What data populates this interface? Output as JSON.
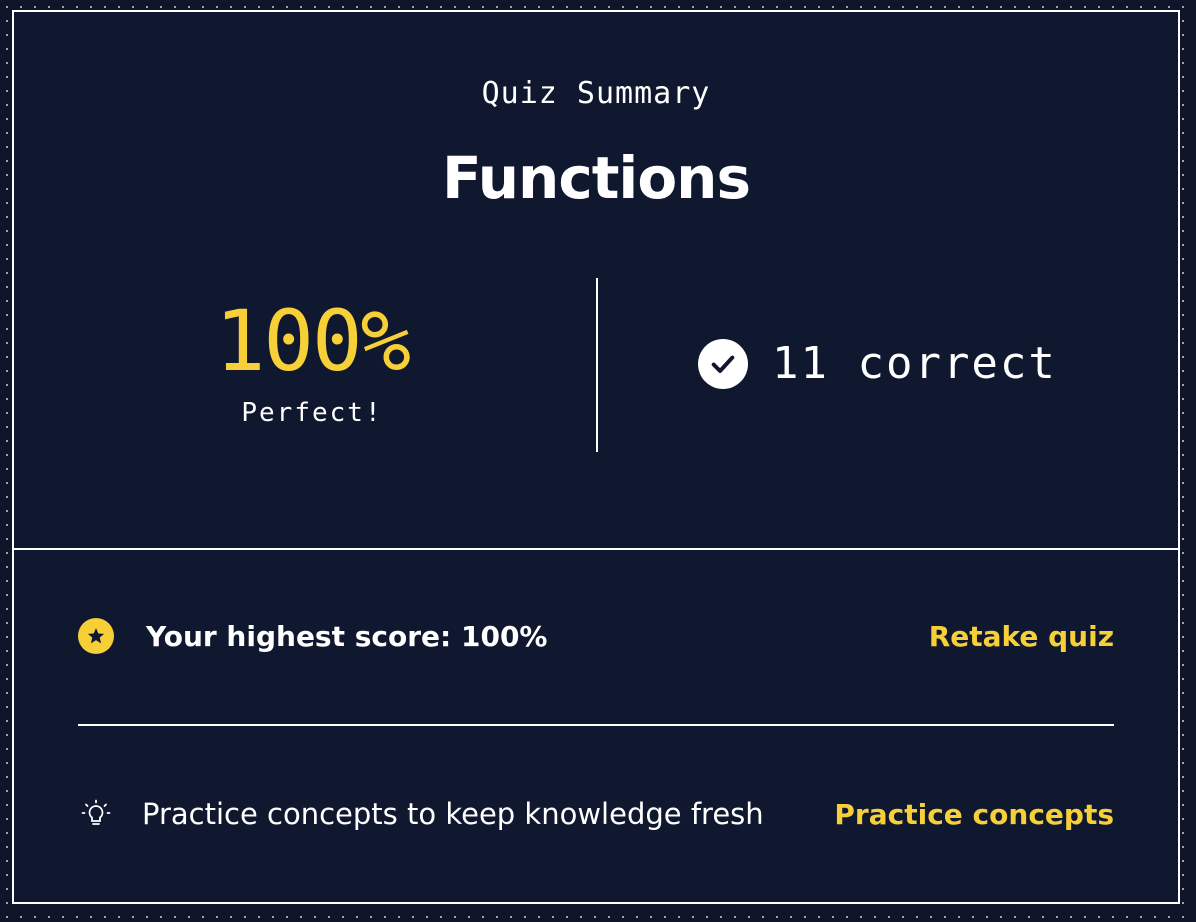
{
  "summary": {
    "eyebrow": "Quiz Summary",
    "title": "Functions",
    "score_value": "100%",
    "score_label": "Perfect!",
    "correct_text": "11 correct"
  },
  "highest": {
    "text": "Your highest score: 100%",
    "action_label": "Retake quiz",
    "icon": "star-icon"
  },
  "practice": {
    "text": "Practice concepts to keep knowledge fresh",
    "action_label": "Practice concepts",
    "icon": "lightbulb-icon"
  },
  "colors": {
    "background": "#0f1629",
    "accent": "#f7d038",
    "text": "#ffffff"
  }
}
